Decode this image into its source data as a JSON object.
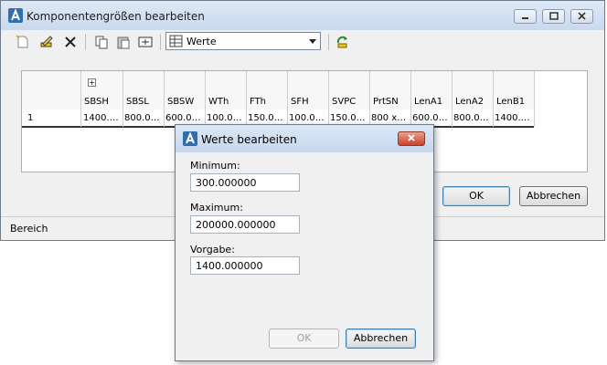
{
  "main_window": {
    "title": "Komponentengrößen bearbeiten",
    "toolbar": {
      "combo_value": "Werte"
    },
    "grid": {
      "columns": [
        "SBSH",
        "SBSL",
        "SBSW",
        "WTh",
        "FTh",
        "SFH",
        "SVPC",
        "PrtSN",
        "LenA1",
        "LenA2",
        "LenB1"
      ],
      "rows": [
        {
          "index": "1",
          "cells": [
            "1400.…",
            "800.0…",
            "600.0…",
            "100.0…",
            "150.0…",
            "100.0…",
            "150.0…",
            "800 x…",
            "600.0…",
            "800.0…",
            "1400.…"
          ]
        }
      ]
    },
    "ok_label": "OK",
    "cancel_label": "Abbrechen",
    "status_text": "Bereich"
  },
  "dialog": {
    "title": "Werte bearbeiten",
    "minimum_label": "Minimum:",
    "minimum_value": "300.000000",
    "maximum_label": "Maximum:",
    "maximum_value": "200000.000000",
    "default_label": "Vorgabe:",
    "default_value": "1400.000000",
    "ok_label": "OK",
    "cancel_label": "Abbrechen"
  },
  "colors": {
    "accent": "#3c7fb1",
    "close_red": "#c9432c"
  },
  "icons": [
    "autocad-icon",
    "minimize-icon",
    "restore-icon",
    "close-icon",
    "new-icon",
    "edit-icon",
    "delete-icon",
    "copy-icon",
    "paste-icon",
    "rename-icon",
    "table-icon",
    "refresh-icon",
    "expand-icon"
  ]
}
